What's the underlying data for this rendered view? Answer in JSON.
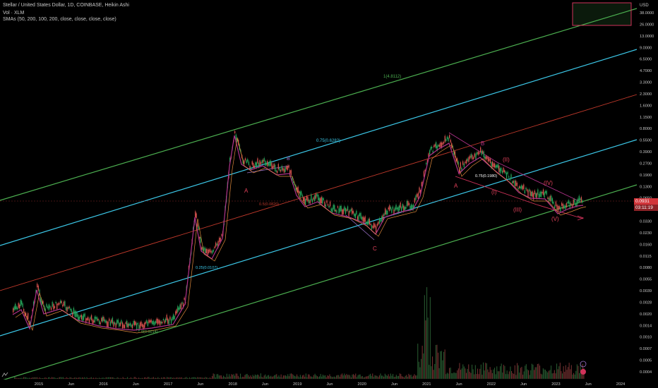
{
  "header": {
    "title": "Stellar / United States Dollar, 1D, COINBASE, Heikin Ashi",
    "vol_label": "Vol · XLM",
    "sma_label": "SMAs (50, 200, 100, 200, close, close, close, close)"
  },
  "price_axis": {
    "currency": "USD",
    "ticks": [
      "38.0000",
      "26.0000",
      "13.0000",
      "9.0000",
      "6.5000",
      "4.7000",
      "3.3000",
      "2.3000",
      "1.6000",
      "1.1500",
      "0.8000",
      "0.5500",
      "0.3900",
      "0.2700",
      "0.1900",
      "0.1300",
      "0.0650",
      "0.0470",
      "0.0330",
      "0.0230",
      "0.0160",
      "0.0115",
      "0.0080",
      "0.0055",
      "0.0039",
      "0.0028",
      "0.0020",
      "0.0014",
      "0.0010",
      "0.0007",
      "0.0005",
      "0.0004"
    ],
    "current_price": "0.0931",
    "countdown": "03:11:19"
  },
  "time_axis": {
    "ticks": [
      "2015",
      "Jun",
      "2016",
      "Jun",
      "2017",
      "Jun",
      "2018",
      "Jun",
      "2019",
      "Jun",
      "2020",
      "Jun",
      "2021",
      "Jun",
      "2022",
      "Jun",
      "2023",
      "Jun",
      "2024"
    ]
  },
  "channel_labels": {
    "top_green": "1(4.8112)",
    "cyan": "0.75(0.6282)",
    "red": "0.5(0.0820)",
    "lower_cyan": "0.25(0.0107)",
    "bottom_green": "0(0.0014)",
    "inner_fib": "0.75(0.1980)"
  },
  "wave_labels": {
    "a1": "A",
    "b1": "B",
    "c1": "C",
    "a2": "A",
    "b2": "B",
    "w2": "(II)",
    "w1": "(I)",
    "w3": "(III)",
    "w4": "(IV)",
    "w5": "(V)"
  },
  "colors": {
    "background": "#000000",
    "green_channel": "#4caf50",
    "cyan_channel": "#3cc8e8",
    "red_channel": "#c0392b",
    "candle_up": "#26a65b",
    "candle_down": "#d9534f",
    "sma": "#b0328a",
    "wave_label": "#e0405a",
    "volume": "#8a3a3a"
  },
  "chart_data": {
    "type": "candlestick",
    "symbol": "XLM/USD",
    "scale": "log",
    "x_range": [
      "2014-09",
      "2024-03"
    ],
    "y_range": [
      0.0004,
      38
    ],
    "series": [
      {
        "name": "",
        "points": [
          [
            "2014-09",
            0.004
          ],
          [
            "2014-12",
            0.006
          ],
          [
            "2015-03",
            0.003
          ],
          [
            "2015-09",
            0.0025
          ],
          [
            "2016-03",
            0.0022
          ],
          [
            "2016-09",
            0.0021
          ],
          [
            "2017-03",
            0.0025
          ],
          [
            "2017-05",
            0.03
          ],
          [
            "2017-08",
            0.018
          ],
          [
            "2017-11",
            0.03
          ],
          [
            "2018-01",
            0.85
          ],
          [
            "2018-04",
            0.35
          ],
          [
            "2018-09",
            0.23
          ],
          [
            "2018-12",
            0.12
          ],
          [
            "2019-06",
            0.11
          ],
          [
            "2019-12",
            0.045
          ],
          [
            "2020-03",
            0.035
          ],
          [
            "2020-09",
            0.075
          ],
          [
            "2021-01",
            0.35
          ],
          [
            "2021-05",
            0.7
          ],
          [
            "2021-07",
            0.25
          ],
          [
            "2021-11",
            0.38
          ],
          [
            "2022-06",
            0.11
          ],
          [
            "2022-12",
            0.075
          ],
          [
            "2023-05",
            0.093
          ]
        ]
      }
    ]
  }
}
